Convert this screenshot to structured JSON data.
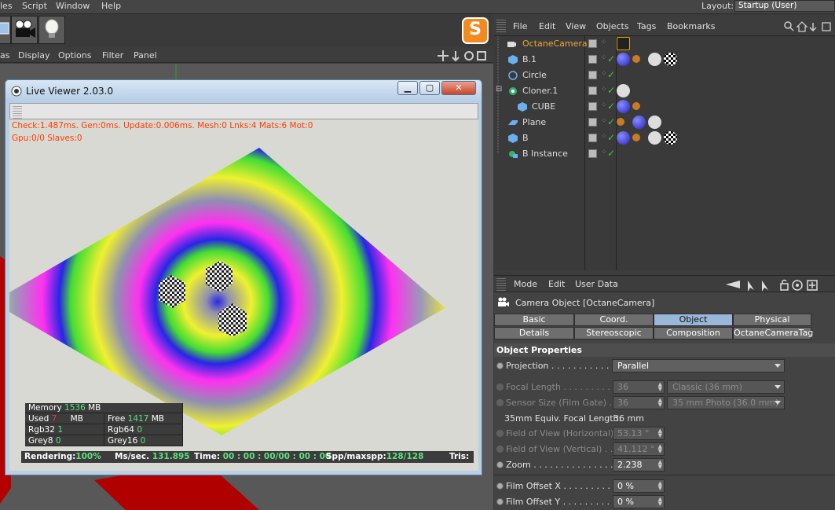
{
  "main_menu": [
    "les",
    "Script",
    "Window",
    "Help"
  ],
  "layout": {
    "label": "Layout:",
    "value": "Startup (User)"
  },
  "viewport_menu": [
    "as",
    "Display",
    "Options",
    "Filter",
    "Panel"
  ],
  "live_viewer": {
    "title": "Live Viewer 2.03.0",
    "stats_line1": "Check:1.487ms. Gen:0ms. Update:0.006ms. Mesh:0 Lnks:4 Mats:6 Mot:0",
    "stats_line2": "Gpu:0/0 Slaves:0",
    "memory": {
      "memory_label": "Memory",
      "memory_value": "1536",
      "memory_unit": "MB",
      "used_label": "Used",
      "used_value": "7",
      "used_unit": "MB",
      "free_label": "Free",
      "free_value": "1417",
      "free_unit": "MB",
      "rgb32_label": "Rgb32",
      "rgb32_value": "1",
      "rgb64_label": "Rgb64",
      "rgb64_value": "0",
      "grey8_label": "Grey8",
      "grey8_value": "0",
      "grey16_label": "Grey16",
      "grey16_value": "0"
    },
    "render_bar": {
      "rendering_label": "Rendering:",
      "rendering_value": "100%",
      "ms_label": "Ms/sec.",
      "ms_value": "131.895",
      "time_label": "Time:",
      "time_value": "00 : 00 : 00/00 : 00 : 00",
      "spp_label": "Spp/maxspp:",
      "spp_value": "128/128",
      "tris_label": "Tris:"
    }
  },
  "object_manager": {
    "menu": [
      "File",
      "Edit",
      "View",
      "Objects",
      "Tags",
      "Bookmarks"
    ],
    "objects": [
      {
        "name": "OctaneCamera",
        "icon": "camera-icon",
        "highlight": true
      },
      {
        "name": "B.1",
        "icon": "cube-icon"
      },
      {
        "name": "Circle",
        "icon": "circle-spline-icon"
      },
      {
        "name": "Cloner.1",
        "icon": "cloner-icon"
      },
      {
        "name": "CUBE",
        "icon": "cube-icon"
      },
      {
        "name": "Plane",
        "icon": "plane-icon"
      },
      {
        "name": "B",
        "icon": "cube-icon"
      },
      {
        "name": "B Instance",
        "icon": "instance-icon"
      }
    ]
  },
  "attribute_manager": {
    "menu": [
      "Mode",
      "Edit",
      "User Data"
    ],
    "title": "Camera Object [OctaneCamera]",
    "tabs_row1": [
      "Basic",
      "Coord.",
      "Object",
      "Physical"
    ],
    "tabs_row2": [
      "Details",
      "Stereoscopic",
      "Composition",
      "OctaneCameraTag"
    ],
    "active_tab": "Object",
    "section": "Object Properties",
    "projection": {
      "label": "Projection . . . . . . . . . . . . .",
      "value": "Parallel"
    },
    "focal_length": {
      "label": "Focal Length . . . . . . . . . . .",
      "value": "36",
      "preset": "Classic (36 mm)"
    },
    "sensor_size": {
      "label": "Sensor Size (Film Gate) . . .",
      "value": "36",
      "preset": "35 mm Photo (36.0 mm)"
    },
    "equiv": {
      "label": "35mm Equiv. Focal Length:",
      "value": "36 mm"
    },
    "fov_h": {
      "label": "Field of View (Horizontal)",
      "value": "53.13 °"
    },
    "fov_v": {
      "label": "Field of View (Vertical) . . .",
      "value": "41.112 °"
    },
    "zoom": {
      "label": "Zoom . . . . . . . . . . . . . . . . .",
      "value": "2.238"
    },
    "film_offset_x": {
      "label": "Film Offset X . . . . . . . . . . .",
      "value": "0 %"
    },
    "film_offset_y": {
      "label": "Film Offset Y . . . . . . . . . . .",
      "value": "0 %"
    }
  },
  "colors": {
    "accent_orange": "#f28a1f",
    "render_text": "#ff3b00",
    "value_green": "#5fe07f",
    "tab_active": "#9ab6d8"
  }
}
